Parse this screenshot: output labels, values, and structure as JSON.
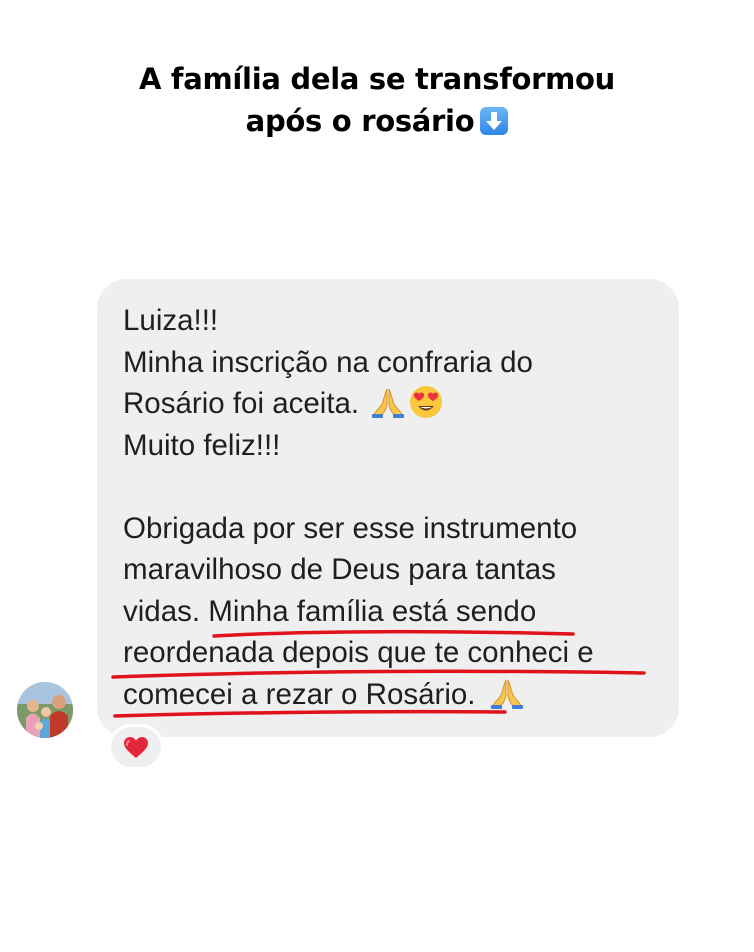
{
  "headline": {
    "line1": "A família dela se transformou",
    "line2": "após o rosário",
    "icon": "down-arrow-emoji-icon"
  },
  "message": {
    "line1": "Luiza!!!",
    "line2": "Minha inscrição na confraria do",
    "line3": "Rosário foi aceita.",
    "line4": "Muito feliz!!!",
    "line5": "Obrigada por ser esse instrumento",
    "line6": "maravilhoso de Deus para tantas",
    "line7a": "vidas. ",
    "line7b": "Minha família está sendo",
    "line8": "reordenada depois que te conheci e",
    "line9": "comecei a rezar o Rosário.",
    "emojis_line3": [
      "praying-hands-icon",
      "heart-eyes-face-icon"
    ],
    "emoji_line9": "praying-hands-icon",
    "underline_color": "#e0121b"
  },
  "reaction": {
    "icon": "red-heart-icon",
    "color": "#e3263a"
  },
  "sender": {
    "avatar": "avatar"
  },
  "colors": {
    "bubble": "#efefef",
    "background": "#ffffff"
  }
}
